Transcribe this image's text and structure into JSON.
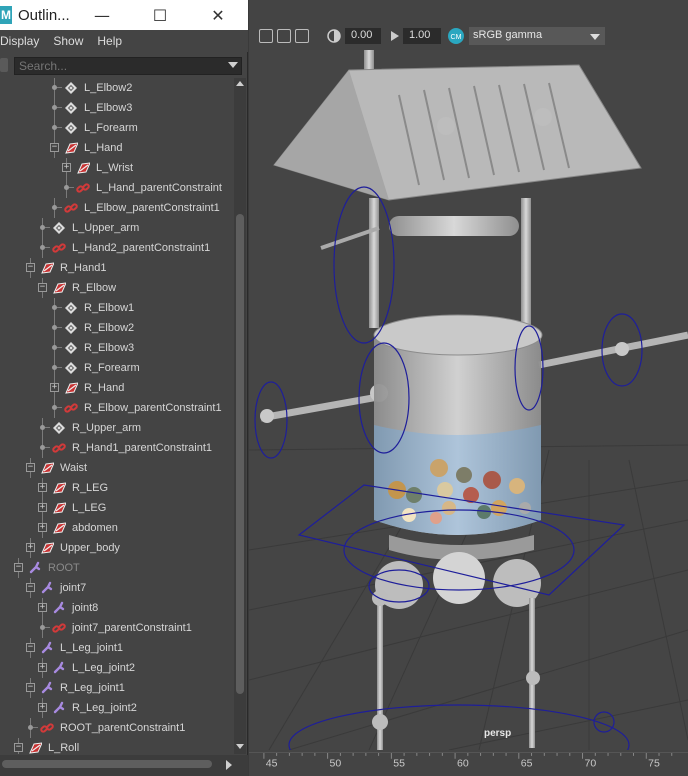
{
  "outliner": {
    "title": "Outlin...",
    "menu": [
      "Display",
      "Show",
      "Help"
    ],
    "search_placeholder": "Search...",
    "items": [
      {
        "label": "L_Elbow2",
        "icon": "joint-icon",
        "depth": 5,
        "expander": null
      },
      {
        "label": "L_Elbow3",
        "icon": "joint-icon",
        "depth": 5,
        "expander": null
      },
      {
        "label": "L_Forearm",
        "icon": "joint-icon",
        "depth": 5,
        "expander": null
      },
      {
        "label": "L_Hand",
        "icon": "ik-handle-icon",
        "depth": 5,
        "expander": "minus"
      },
      {
        "label": "L_Wrist",
        "icon": "ik-handle-icon",
        "depth": 6,
        "expander": "plus"
      },
      {
        "label": "L_Hand_parentConstraint",
        "icon": "constraint-icon",
        "depth": 6,
        "expander": null
      },
      {
        "label": "L_Elbow_parentConstraint1",
        "icon": "constraint-icon",
        "depth": 5,
        "expander": null
      },
      {
        "label": "L_Upper_arm",
        "icon": "joint-icon",
        "depth": 4,
        "expander": null
      },
      {
        "label": "L_Hand2_parentConstraint1",
        "icon": "constraint-icon",
        "depth": 4,
        "expander": null
      },
      {
        "label": "R_Hand1",
        "icon": "ik-handle-icon",
        "depth": 3,
        "expander": "minus"
      },
      {
        "label": "R_Elbow",
        "icon": "ik-handle-icon",
        "depth": 4,
        "expander": "minus"
      },
      {
        "label": "R_Elbow1",
        "icon": "joint-icon",
        "depth": 5,
        "expander": null
      },
      {
        "label": "R_Elbow2",
        "icon": "joint-icon",
        "depth": 5,
        "expander": null
      },
      {
        "label": "R_Elbow3",
        "icon": "joint-icon",
        "depth": 5,
        "expander": null
      },
      {
        "label": "R_Forearm",
        "icon": "joint-icon",
        "depth": 5,
        "expander": null
      },
      {
        "label": "R_Hand",
        "icon": "ik-handle-icon",
        "depth": 5,
        "expander": "plus"
      },
      {
        "label": "R_Elbow_parentConstraint1",
        "icon": "constraint-icon",
        "depth": 5,
        "expander": null
      },
      {
        "label": "R_Upper_arm",
        "icon": "joint-icon",
        "depth": 4,
        "expander": null
      },
      {
        "label": "R_Hand1_parentConstraint1",
        "icon": "constraint-icon",
        "depth": 4,
        "expander": null
      },
      {
        "label": "Waist",
        "icon": "ik-handle-icon",
        "depth": 3,
        "expander": "minus"
      },
      {
        "label": "R_LEG",
        "icon": "ik-handle-icon",
        "depth": 4,
        "expander": "plus"
      },
      {
        "label": "L_LEG",
        "icon": "ik-handle-icon",
        "depth": 4,
        "expander": "plus"
      },
      {
        "label": "abdomen",
        "icon": "ik-handle-icon",
        "depth": 4,
        "expander": "plus"
      },
      {
        "label": "Upper_body",
        "icon": "ik-handle-icon",
        "depth": 3,
        "expander": "plus"
      },
      {
        "label": "ROOT",
        "icon": "bone-icon",
        "depth": 2,
        "expander": "minus",
        "dim": true
      },
      {
        "label": "joint7",
        "icon": "bone-icon",
        "depth": 3,
        "expander": "minus"
      },
      {
        "label": "joint8",
        "icon": "bone-icon",
        "depth": 4,
        "expander": "plus"
      },
      {
        "label": "joint7_parentConstraint1",
        "icon": "constraint-icon",
        "depth": 4,
        "expander": null
      },
      {
        "label": "L_Leg_joint1",
        "icon": "bone-icon",
        "depth": 3,
        "expander": "minus"
      },
      {
        "label": "L_Leg_joint2",
        "icon": "bone-icon",
        "depth": 4,
        "expander": "plus"
      },
      {
        "label": "R_Leg_joint1",
        "icon": "bone-icon",
        "depth": 3,
        "expander": "minus"
      },
      {
        "label": "R_Leg_joint2",
        "icon": "bone-icon",
        "depth": 4,
        "expander": "plus"
      },
      {
        "label": "ROOT_parentConstraint1",
        "icon": "constraint-icon",
        "depth": 3,
        "expander": null
      },
      {
        "label": "L_Roll",
        "icon": "ik-handle-icon",
        "depth": 2,
        "expander": "minus"
      }
    ]
  },
  "viewport": {
    "exposure": "0.00",
    "gamma": "1.00",
    "color_space": "sRGB gamma",
    "camera_label": "persp",
    "ruler_ticks": [
      "45",
      "50",
      "55",
      "60",
      "65",
      "70",
      "75"
    ]
  },
  "colors": {
    "panel_bg": "#444444",
    "constraint_red": "#d23a3a",
    "ik_handle_red": "#c83232",
    "joint_white": "#e0e0e0",
    "bone_purple": "#a88ae0",
    "manipulator_blue": "#1e1e9a"
  }
}
